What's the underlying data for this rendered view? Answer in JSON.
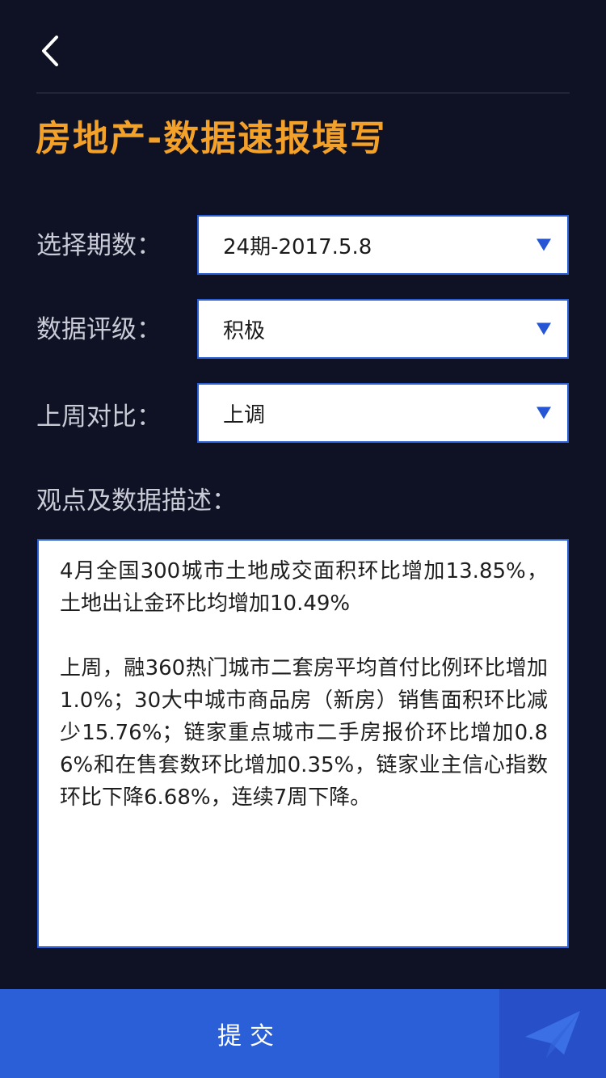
{
  "header": {
    "back_icon": "chevron-left-icon",
    "title": "房地产-数据速报填写"
  },
  "form": {
    "period": {
      "label": "选择期数：",
      "value": "24期-2017.5.8"
    },
    "rating": {
      "label": "数据评级：",
      "value": "积极"
    },
    "compare": {
      "label": "上周对比：",
      "value": "上调"
    },
    "description": {
      "label": "观点及数据描述：",
      "value": "4月全国300城市土地成交面积环比增加13.85%，土地出让金环比均增加10.49%\n\n上周，融360热门城市二套房平均首付比例环比增加1.0%；30大中城市商品房（新房）销售面积环比减少15.76%；链家重点城市二手房报价环比增加0.86%和在售套数环比增加0.35%，链家业主信心指数环比下降6.68%，连续7周下降。"
    }
  },
  "footer": {
    "submit_label": "提交",
    "send_icon": "paper-plane-icon"
  },
  "colors": {
    "background": "#0e1224",
    "title": "#f4a12a",
    "accent": "#2a5fd8"
  }
}
